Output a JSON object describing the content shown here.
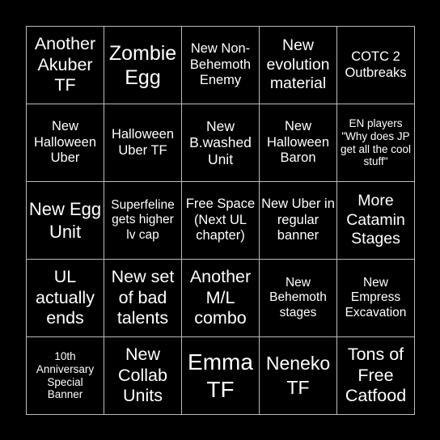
{
  "board": {
    "cells": [
      {
        "text": "Another Akuber TF"
      },
      {
        "text": "Zombie Egg"
      },
      {
        "text": "New Non-Behemoth Enemy"
      },
      {
        "text": "New evolution material"
      },
      {
        "text": "COTC 2 Outbreaks"
      },
      {
        "text": "New Halloween Uber"
      },
      {
        "text": "Halloween Uber TF"
      },
      {
        "text": "New B.washed Unit"
      },
      {
        "text": "New Halloween Baron"
      },
      {
        "text": "EN players \"Why does JP get all the cool stuff\""
      },
      {
        "text": "New Egg Unit"
      },
      {
        "text": "Superfeline gets higher lv cap"
      },
      {
        "text": "Free Space (Next UL chapter)"
      },
      {
        "text": "New Uber in regular banner"
      },
      {
        "text": "More Catamin Stages"
      },
      {
        "text": "UL actually ends"
      },
      {
        "text": "New set of bad talents"
      },
      {
        "text": "Another M/L combo"
      },
      {
        "text": "New Behemoth stages"
      },
      {
        "text": "New Empress Excavation"
      },
      {
        "text": "10th Anniversary Special Banner"
      },
      {
        "text": "New Collab Units"
      },
      {
        "text": "Emma TF"
      },
      {
        "text": "Neneko TF"
      },
      {
        "text": "Tons of Free Catfood"
      }
    ]
  }
}
